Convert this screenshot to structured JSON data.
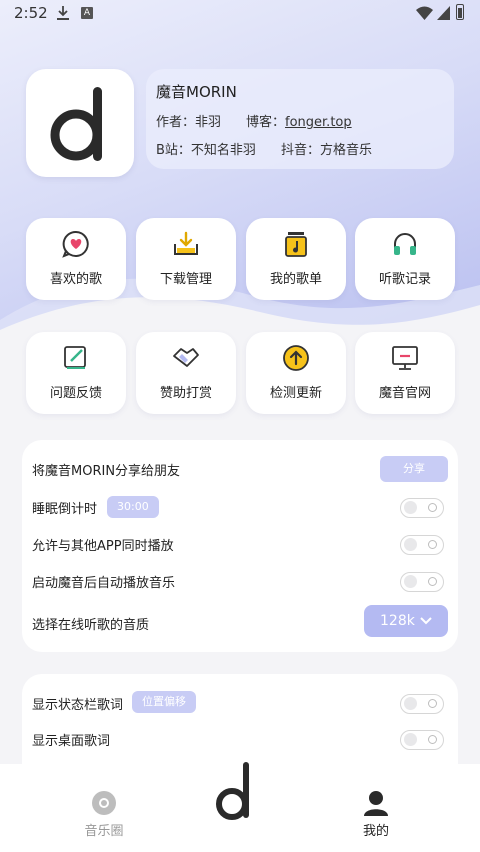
{
  "status_bar": {
    "time": "2:52",
    "a_badge": "A",
    "icons": [
      "download-icon",
      "a-badge-icon",
      "wifi-icon",
      "signal-icon",
      "battery-icon"
    ]
  },
  "header": {
    "app_name": "魔音MORIN",
    "author_label": "作者：",
    "author_value": "非羽",
    "blog_label": "博客：",
    "blog_value": "fonger.top",
    "bilibili_label": "B站：",
    "bilibili_value": "不知名非羽",
    "douyin_label": "抖音：",
    "douyin_value": "方格音乐"
  },
  "quick_grid_1": [
    {
      "label": "喜欢的歌",
      "icon": "heart-chat-icon"
    },
    {
      "label": "下载管理",
      "icon": "download-tray-icon"
    },
    {
      "label": "我的歌单",
      "icon": "playlist-icon"
    },
    {
      "label": "听歌记录",
      "icon": "headphones-icon"
    }
  ],
  "quick_grid_2": [
    {
      "label": "问题反馈",
      "icon": "feedback-edit-icon"
    },
    {
      "label": "赞助打赏",
      "icon": "handshake-icon"
    },
    {
      "label": "检测更新",
      "icon": "update-arrow-icon"
    },
    {
      "label": "魔音官网",
      "icon": "monitor-icon"
    }
  ],
  "settings_1": {
    "share_label": "将魔音MORIN分享给朋友",
    "share_button": "分享",
    "sleep_label": "睡眠倒计时",
    "sleep_value": "30:00",
    "allow_mix_label": "允许与其他APP同时播放",
    "autoplay_label": "启动魔音后自动播放音乐",
    "quality_label": "选择在线听歌的音质",
    "quality_value": "128k"
  },
  "settings_2": {
    "statusbar_lyrics_label": "显示状态栏歌词",
    "position_button": "位置偏移",
    "desktop_lyrics_label": "显示桌面歌词"
  },
  "bottom_nav": {
    "left_label": "音乐圈",
    "right_label": "我的"
  },
  "colors": {
    "accent": "#b4baf2",
    "accent_light": "#c8ccf5",
    "gradient_top": "#eceefb",
    "gradient_bottom": "#b9bff0",
    "logo_dark": "#2a2a2a",
    "yellow": "#f6c21a",
    "pink": "#e8456a",
    "green": "#36b58a"
  }
}
